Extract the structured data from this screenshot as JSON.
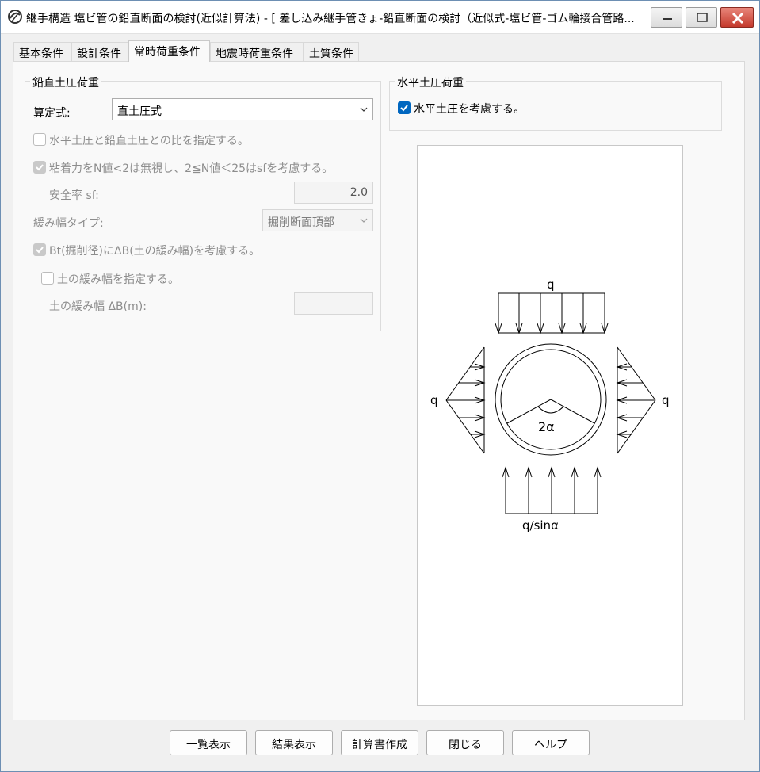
{
  "window": {
    "title": "継手構造 塩ビ管の鉛直断面の検討(近似計算法) - [ 差し込み継手管きょ-鉛直断面の検討（近似式-塩ビ管-ゴム輪接合管路..."
  },
  "tabs": [
    {
      "label": "基本条件"
    },
    {
      "label": "設計条件"
    },
    {
      "label": "常時荷重条件",
      "active": true
    },
    {
      "label": "地震時荷重条件"
    },
    {
      "label": "土質条件"
    }
  ],
  "vertical_group": {
    "title": "鉛直土圧荷重",
    "formula_label": "算定式:",
    "formula_value": "直土圧式",
    "ratio_checkbox": "水平土圧と鉛直土圧との比を指定する。",
    "adhesion_checkbox": "粘着力をN値<2は無視し、2≦N値＜25はsfを考慮する。",
    "safety_label": "安全率 sf:",
    "safety_value": "2.0",
    "loose_type_label": "緩み幅タイプ:",
    "loose_type_value": "掘削断面頂部",
    "bt_checkbox": "Bt(掘削径)にΔB(土の緩み幅)を考慮する。",
    "loose_width_checkbox": "土の緩み幅を指定する。",
    "loose_width_label": "土の緩み幅 ΔB(m):",
    "loose_width_value": ""
  },
  "horizontal_group": {
    "title": "水平土圧荷重",
    "consider_checkbox": "水平土圧を考慮する。"
  },
  "diagram": {
    "top_load": "q",
    "left_load": "q",
    "right_load": "q",
    "angle_label": "2α",
    "bottom_load": "q/sinα"
  },
  "buttons": {
    "list": "一覧表示",
    "result": "結果表示",
    "report": "計算書作成",
    "close": "閉じる",
    "help": "ヘルプ"
  },
  "colors": {
    "accent": "#0067c0",
    "close_button": "#c4392c"
  }
}
